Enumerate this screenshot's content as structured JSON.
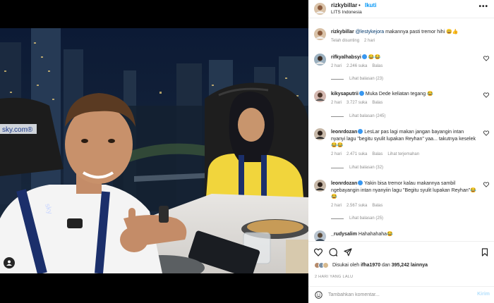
{
  "post": {
    "username": "rizkybillar",
    "follow_label": "Ikuti",
    "dot": "•",
    "location": "LITS Indonesia",
    "more": "•••",
    "photo_texts": {
      "badge_left": "sky.com®",
      "lanyard": "sky"
    }
  },
  "caption": {
    "username": "rizkybillar",
    "mention": "@lestykejora",
    "text": " makannya pasti tremor hihi 😀👍",
    "edited": "Telah disunting",
    "time": "2 hari"
  },
  "comments": [
    {
      "username": "rifkyalhabsyi",
      "text": " 😂😂",
      "time": "2 hari",
      "likes": "2.246 suka",
      "reply": "Balas",
      "view_replies": "Lihat balasan (23)",
      "translate": ""
    },
    {
      "username": "kikysaputrii",
      "text": " Muka Dede keliatan tegang 😂",
      "time": "2 hari",
      "likes": "3.727 suka",
      "reply": "Balas",
      "view_replies": "Lihat balasan (245)",
      "translate": ""
    },
    {
      "username": "leonrdozan",
      "text": " LesLar pas lagi makan jangan bayangin intan nyanyi lagu \"begitu syulit lupakan Reyhan\" yaa... takutnya keselek😂😂",
      "time": "2 hari",
      "likes": "2.471 suka",
      "reply": "Balas",
      "view_replies": "Lihat balasan (32)",
      "translate": "Lihat terjemahan"
    },
    {
      "username": "leonrdozan",
      "text": " Yakin bisa tremor kalau makannya sambil ngebayangin intan nyanyiin lagu \"Begitu syulit lupakan Reyhan\"😂😂",
      "time": "2 hari",
      "likes": "2.567 suka",
      "reply": "Balas",
      "view_replies": "Lihat balasan (25)",
      "translate": ""
    },
    {
      "username": "_rudysalim",
      "text": " Hahahahaha😂",
      "time": "",
      "likes": "",
      "reply": "",
      "view_replies": "",
      "translate": ""
    }
  ],
  "likes_line": {
    "prefix": "Disukai oleh ",
    "user": "ifha1970",
    "mid": " dan ",
    "count": "395,242 lainnya"
  },
  "time_ago": "2 HARI YANG LALU",
  "add_comment": {
    "placeholder": "Tambahkan komentar...",
    "post_label": "Kirim"
  },
  "icons": [
    "heart-icon",
    "comment-icon",
    "share-icon",
    "bookmark-icon",
    "emoji-icon",
    "user-tag-icon",
    "more-icon"
  ],
  "colors": {
    "link": "#0095f6",
    "verified": "#3897f0",
    "lanyard": "#1b2f6b",
    "jacket": "#f1d53c"
  }
}
